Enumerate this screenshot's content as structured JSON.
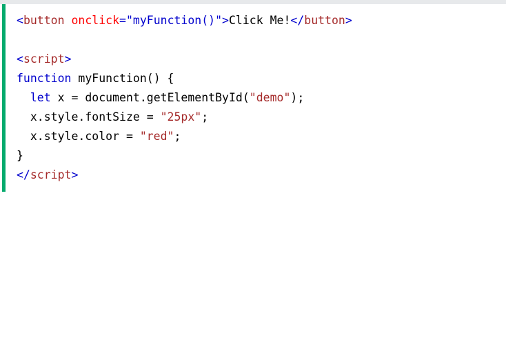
{
  "code_lines": [
    [
      {
        "t": "bracket",
        "v": "<"
      },
      {
        "t": "tag",
        "v": "button"
      },
      {
        "t": "plain",
        "v": " "
      },
      {
        "t": "attr",
        "v": "onclick"
      },
      {
        "t": "attrval",
        "v": "=\"myFunction()\""
      },
      {
        "t": "bracket",
        "v": ">"
      },
      {
        "t": "plain",
        "v": "Click Me!"
      },
      {
        "t": "bracket",
        "v": "</"
      },
      {
        "t": "tag",
        "v": "button"
      },
      {
        "t": "bracket",
        "v": ">"
      }
    ],
    [],
    [
      {
        "t": "bracket",
        "v": "<"
      },
      {
        "t": "tag",
        "v": "script"
      },
      {
        "t": "bracket",
        "v": ">"
      }
    ],
    [
      {
        "t": "kw",
        "v": "function"
      },
      {
        "t": "plain",
        "v": " myFunction() {"
      }
    ],
    [
      {
        "t": "plain",
        "v": "  "
      },
      {
        "t": "kw",
        "v": "let"
      },
      {
        "t": "plain",
        "v": " x = document.getElementById("
      },
      {
        "t": "str",
        "v": "\"demo\""
      },
      {
        "t": "plain",
        "v": ");"
      }
    ],
    [
      {
        "t": "plain",
        "v": "  x.style.fontSize = "
      },
      {
        "t": "str",
        "v": "\"25px\""
      },
      {
        "t": "plain",
        "v": ";"
      }
    ],
    [
      {
        "t": "plain",
        "v": "  x.style.color = "
      },
      {
        "t": "str",
        "v": "\"red\""
      },
      {
        "t": "plain",
        "v": ";"
      }
    ],
    [
      {
        "t": "plain",
        "v": "}"
      }
    ],
    [
      {
        "t": "bracket",
        "v": "</"
      },
      {
        "t": "tag",
        "v": "script"
      },
      {
        "t": "bracket",
        "v": ">"
      }
    ]
  ],
  "colors": {
    "accent_border": "#04aa6d",
    "tag": "#a52a2a",
    "bracket": "#0000cd",
    "attribute": "#ff0000",
    "keyword": "#0000cd",
    "string": "#a52a2a"
  }
}
